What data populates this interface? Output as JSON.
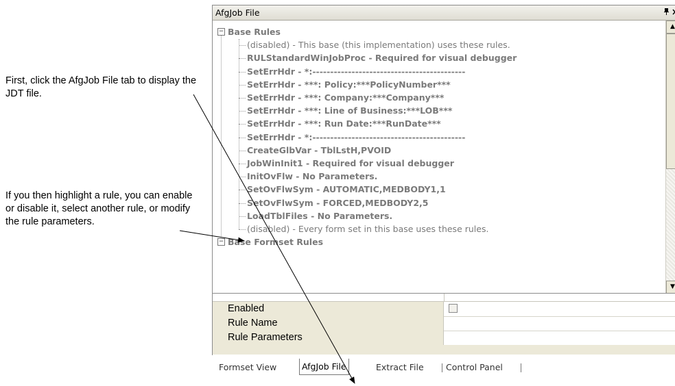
{
  "callouts": {
    "first": "First, click the AfgJob File tab to display the JDT file.",
    "second": "If you then highlight a rule, you can enable or disable it, select another rule, or modify the rule parameters."
  },
  "panel": {
    "title": "AfgJob File",
    "pin_glyph": "ᵖ",
    "close_glyph": "×"
  },
  "tree": {
    "root_label": "Base Rules",
    "rows": [
      {
        "text": "(disabled)  -  This base (this implementation) uses these rules.",
        "bold": false
      },
      {
        "text": "RULStandardWinJobProc - Required for visual debugger",
        "bold": true
      },
      {
        "text": "SetErrHdr - *:-------------------------------------------",
        "bold": true
      },
      {
        "text": "SetErrHdr - ***: Policy:***PolicyNumber***",
        "bold": true
      },
      {
        "text": "SetErrHdr - ***: Company:***Company***",
        "bold": true
      },
      {
        "text": "SetErrHdr - ***: Line of Business:***LOB***",
        "bold": true
      },
      {
        "text": "SetErrHdr - ***: Run Date:***RunDate***",
        "bold": true
      },
      {
        "text": "SetErrHdr - *:-------------------------------------------",
        "bold": true
      },
      {
        "text": "CreateGlbVar - TblLstH,PVOID",
        "bold": true
      },
      {
        "text": "JobWinInit1 - Required for visual debugger",
        "bold": true
      },
      {
        "text": "InitOvFlw - No Parameters.",
        "bold": true
      },
      {
        "text": "SetOvFlwSym - AUTOMATIC,MEDBODY1,1",
        "bold": true
      },
      {
        "text": "SetOvFlwSym - FORCED,MEDBODY2,5",
        "bold": true
      },
      {
        "text": "LoadTblFiles - No Parameters.",
        "bold": true
      },
      {
        "text": "(disabled)  -  Every form set in this base uses these rules.",
        "bold": false
      }
    ],
    "second_root_label": "Base Formset Rules"
  },
  "properties": [
    {
      "name": "Enabled",
      "value_type": "checkbox",
      "checked": false
    },
    {
      "name": "Rule Name",
      "value": ""
    },
    {
      "name": "Rule Parameters",
      "value": ""
    }
  ],
  "tabs": [
    {
      "label": "Formset View",
      "active": false
    },
    {
      "label": "AfgJob File",
      "active": true
    },
    {
      "label": "Extract File",
      "active": false
    },
    {
      "label": "Control Panel",
      "active": false
    }
  ],
  "colors": {
    "tree_text": "#7a7a7a",
    "panel_chrome": "#ece9d8",
    "arrow": "#000000"
  }
}
